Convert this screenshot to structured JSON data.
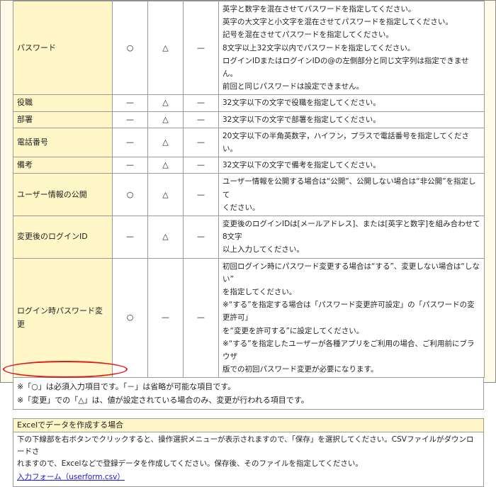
{
  "rows": [
    {
      "name": "パスワード",
      "req": "○",
      "add": "△",
      "change": "—",
      "desc": [
        "英字と数字を混在させてパスワードを指定してください。",
        "英字の大文字と小文字を混在させてパスワードを指定してください。",
        "記号を混在させてパスワードを指定してください。",
        "8文字以上32文字以内でパスワードを指定してください。",
        "ログインIDまたはログインIDの@の左側部分と同じ文字列は指定できません。",
        "前回と同じパスワードは設定できません。"
      ]
    },
    {
      "name": "役職",
      "req": "—",
      "add": "△",
      "change": "—",
      "desc": [
        "32文字以下の文字で役職を指定してください。"
      ]
    },
    {
      "name": "部署",
      "req": "—",
      "add": "△",
      "change": "—",
      "desc": [
        "32文字以下の文字で部署を指定してください。"
      ]
    },
    {
      "name": "電話番号",
      "req": "—",
      "add": "△",
      "change": "—",
      "desc": [
        "20文字以下の半角英数字，ハイフン，プラスで電話番号を指定してください。"
      ]
    },
    {
      "name": "備考",
      "req": "—",
      "add": "△",
      "change": "—",
      "desc": [
        "32文字以下の文字で備考を指定してください。"
      ]
    },
    {
      "name": "ユーザー情報の公開",
      "req": "○",
      "add": "△",
      "change": "—",
      "desc": [
        "ユーザー情報を公開する場合は“公開”、公開しない場合は“非公開”を指定して",
        "ください。"
      ]
    },
    {
      "name": "変更後のログインID",
      "req": "—",
      "add": "△",
      "change": "—",
      "desc": [
        "変更後のログインIDは[メールアドレス]、または[英字と数字]を組み合わせて8文字",
        "以上入力してください。"
      ]
    },
    {
      "name": "ログイン時パスワード変更",
      "req": "○",
      "add": "—",
      "change": "—",
      "desc": [
        "初回ログイン時にパスワード変更する場合は“する”、変更しない場合は“しない”",
        "を指定してください。",
        "※“する”を指定する場合は「パスワード変更許可設定」の「パスワードの変更許可」",
        "を“変更を許可する”に設定してください。",
        "※“する”を指定したユーザーが各種アプリをご利用の場合、ご利用前にブラウザ",
        "版での初回パスワード変更が必要になります。"
      ]
    }
  ],
  "notes": [
    "※「○」は必須入力項目です。「－」は省略が可能な項目です。",
    "※「変更」での「△」は、値が設定されている場合のみ、変更が行われる項目です。"
  ],
  "excel": {
    "title": "Excelでデータを作成する場合",
    "body1": "下の下線部を右ボタンでクリックすると、操作選択メニューが表示されますので、「保存」を選択してください。CSVファイルがダウンロードさ",
    "body2": "れますので、Excelなどで登録データを作成してください。保存後、そのファイルを指定してください。",
    "link": "入力フォーム（userform.csv）"
  }
}
